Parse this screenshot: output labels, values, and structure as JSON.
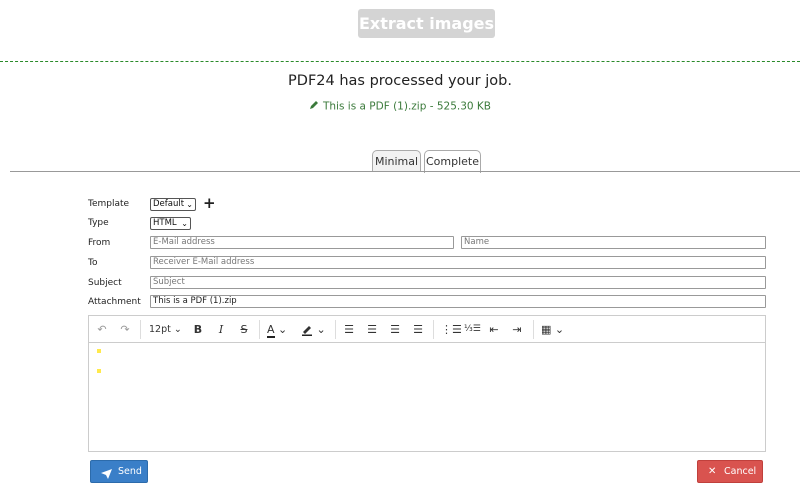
{
  "header": {
    "extract_button": "Extract images"
  },
  "result": {
    "message": "PDF24 has processed your job.",
    "file_link": "This is a PDF (1).zip - 525.30 KB"
  },
  "tabs": [
    {
      "label": "Minimal",
      "active": false
    },
    {
      "label": "Complete",
      "active": true
    }
  ],
  "form": {
    "template": {
      "label": "Template",
      "value": "Default"
    },
    "type": {
      "label": "Type",
      "value": "HTML"
    },
    "from": {
      "label": "From",
      "email_placeholder": "E-Mail address",
      "name_placeholder": "Name"
    },
    "to": {
      "label": "To",
      "placeholder": "Receiver E-Mail address"
    },
    "subject": {
      "label": "Subject",
      "placeholder": "Subject"
    },
    "attachment": {
      "label": "Attachment",
      "value": "This is a PDF (1).zip"
    }
  },
  "editor": {
    "font_size": "12pt"
  },
  "buttons": {
    "send": "Send",
    "cancel": "Cancel"
  },
  "colors": {
    "send": "#3a7fc8",
    "cancel": "#d9534f",
    "link_green": "#3b7a3b",
    "dashed_line": "#2a8a2a"
  }
}
